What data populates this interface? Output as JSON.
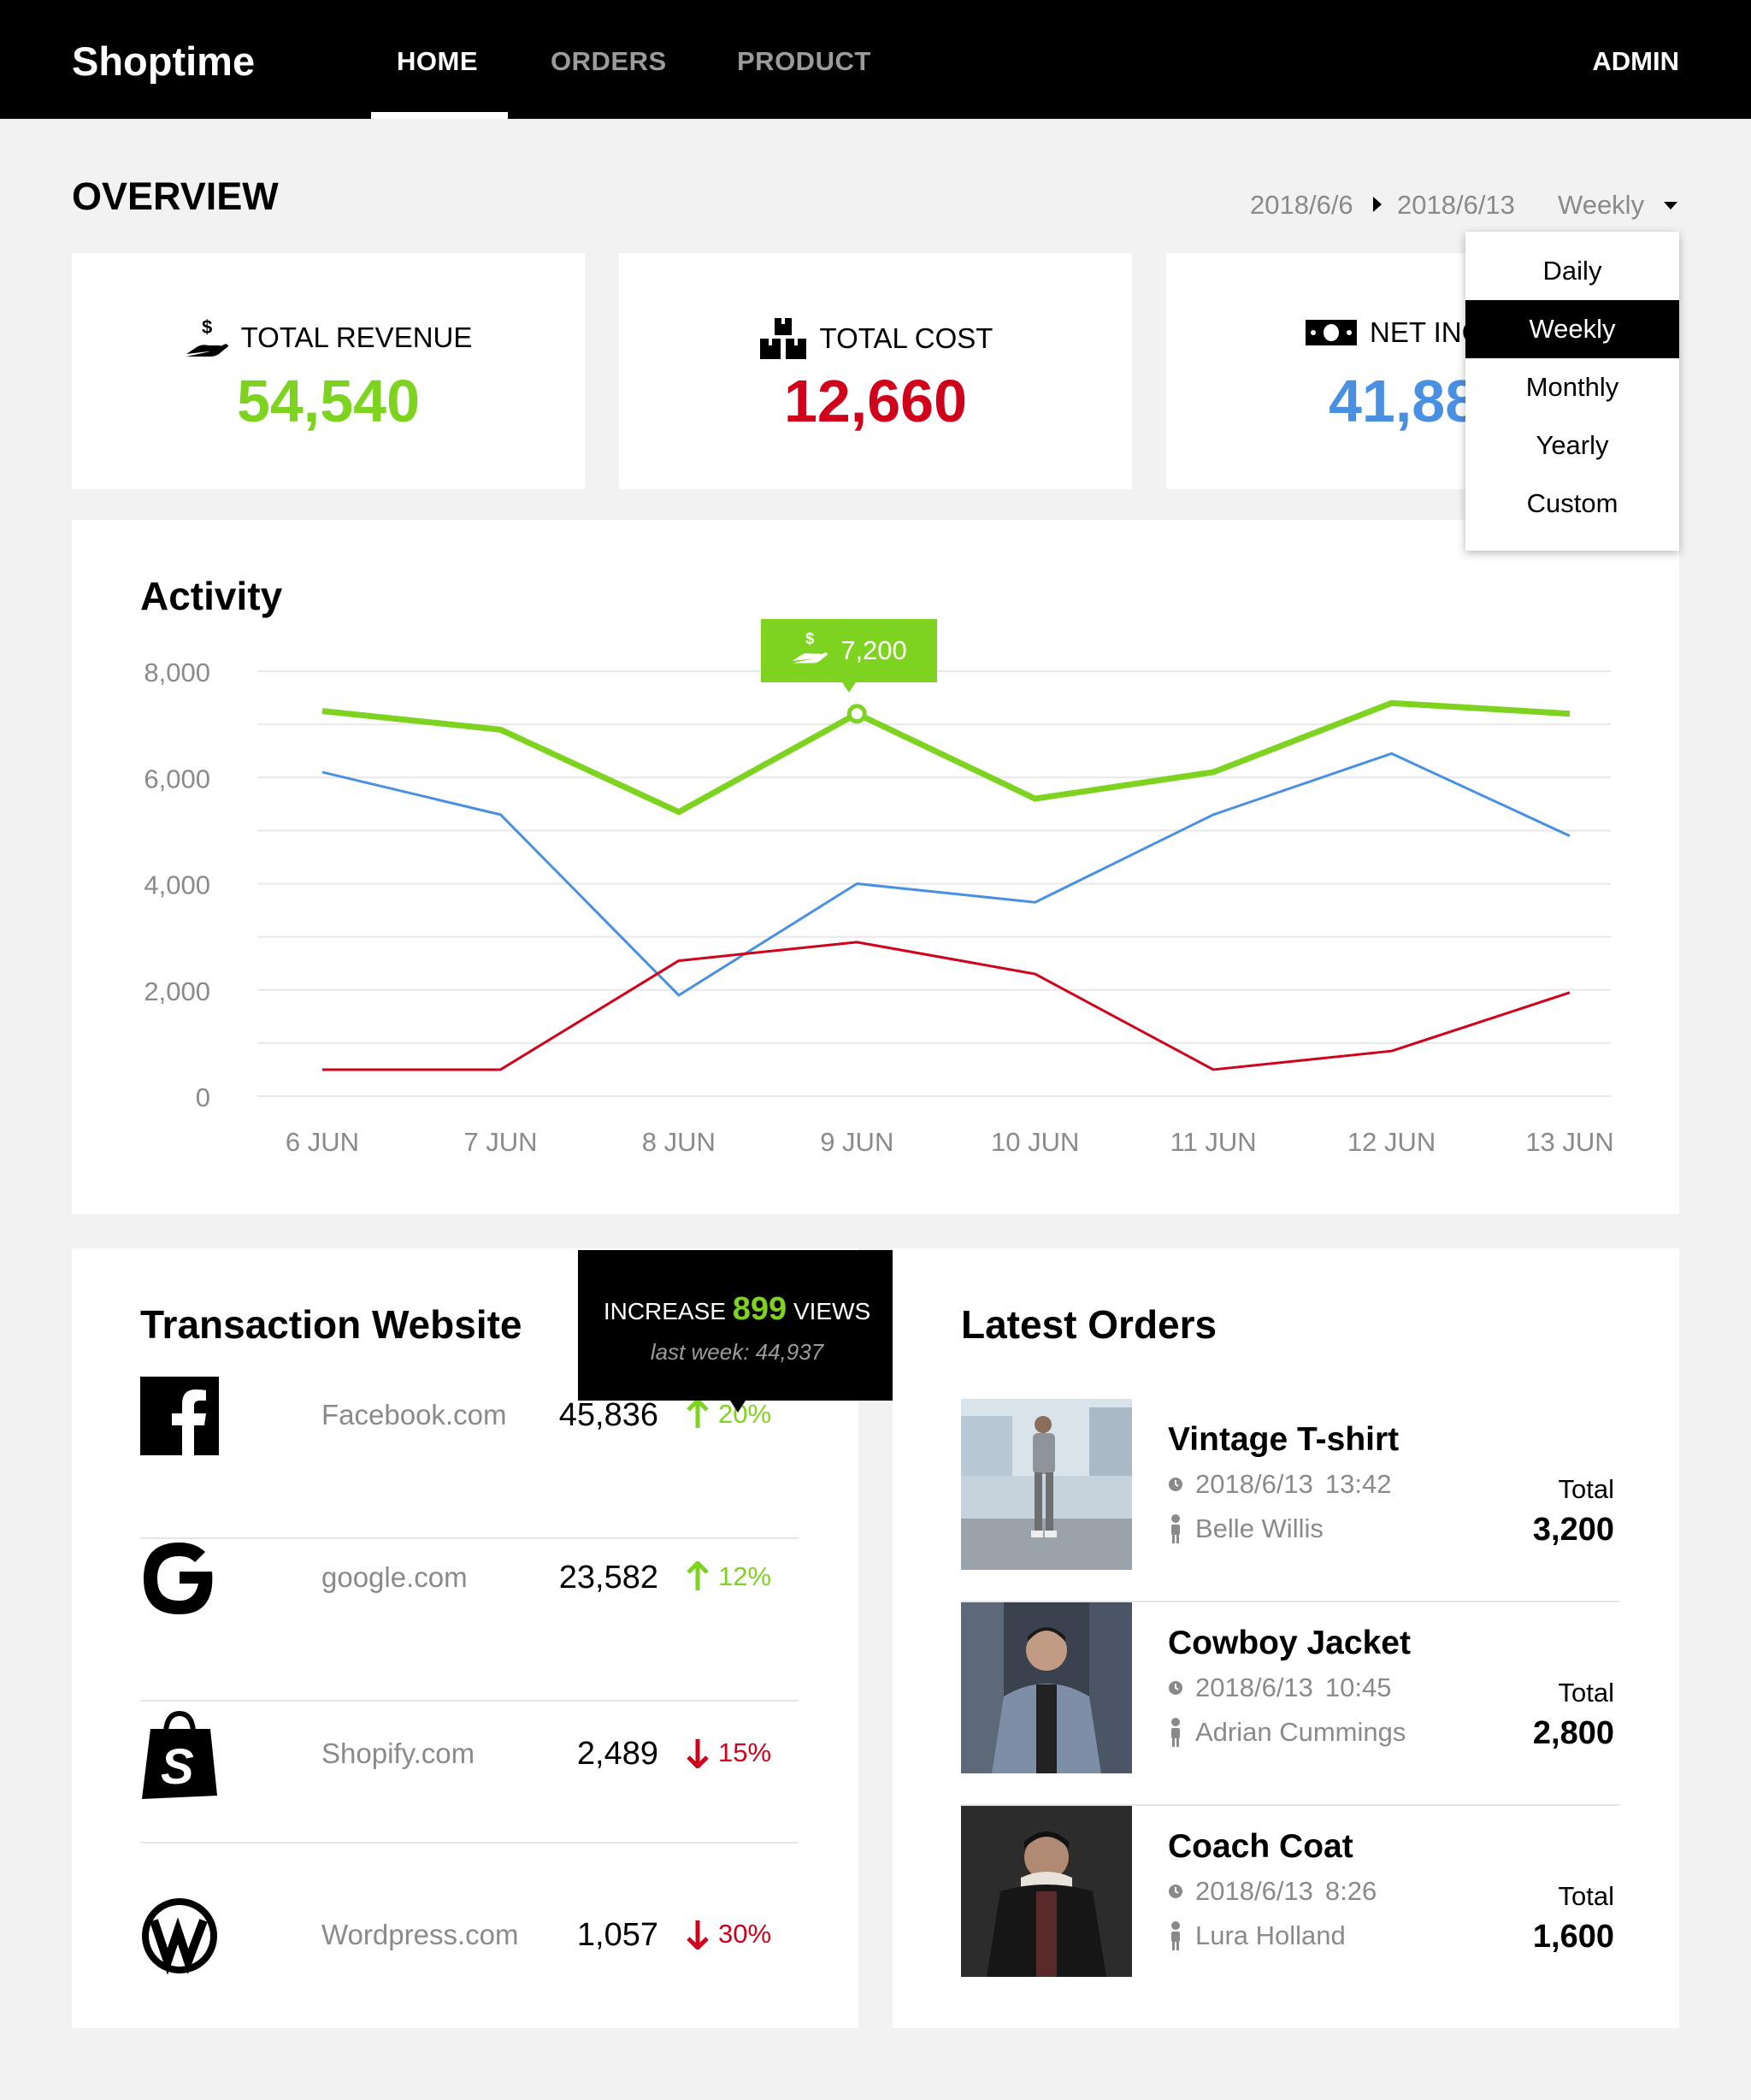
{
  "nav": {
    "brand": "Shoptime",
    "tabs": [
      {
        "label": "HOME",
        "active": true
      },
      {
        "label": "ORDERS",
        "active": false
      },
      {
        "label": "PRODUCT",
        "active": false
      }
    ],
    "user": "ADMIN"
  },
  "overview": {
    "title": "OVERVIEW",
    "date_from": "2018/6/6",
    "date_to": "2018/6/13",
    "period": "Weekly",
    "period_options": [
      {
        "label": "Daily",
        "selected": false
      },
      {
        "label": "Weekly",
        "selected": true
      },
      {
        "label": "Monthly",
        "selected": false
      },
      {
        "label": "Yearly",
        "selected": false
      },
      {
        "label": "Custom",
        "selected": false
      }
    ]
  },
  "stats": [
    {
      "label": "TOTAL REVENUE",
      "value": "54,540",
      "color": "#7ed321",
      "icon": "hand-dollar-icon"
    },
    {
      "label": "TOTAL COST",
      "value": "12,660",
      "color": "#d0021b",
      "icon": "boxes-icon"
    },
    {
      "label": "NET INC",
      "value": "41,88",
      "color": "#4a90e2",
      "icon": "banknote-icon"
    }
  ],
  "activity": {
    "title": "Activity",
    "tooltip_value": "7,200",
    "chart_data": {
      "type": "line",
      "categories": [
        "6 JUN",
        "7 JUN",
        "8 JUN",
        "9 JUN",
        "10 JUN",
        "11 JUN",
        "12 JUN",
        "13 JUN"
      ],
      "ylim": [
        0,
        8000
      ],
      "yticks": [
        "0",
        "2,000",
        "4,000",
        "6,000",
        "8,000"
      ],
      "ytick_values": [
        0,
        2000,
        4000,
        6000,
        8000
      ],
      "grid": true,
      "series": [
        {
          "color": "#7ed321",
          "values": [
            7250,
            6900,
            5350,
            7200,
            5600,
            6100,
            7400,
            7200
          ]
        },
        {
          "color": "#4a90e2",
          "values": [
            6100,
            5300,
            1900,
            4000,
            3650,
            5300,
            6450,
            4900
          ]
        },
        {
          "color": "#d0021b",
          "values": [
            500,
            500,
            2550,
            2900,
            2300,
            500,
            850,
            1950
          ]
        }
      ]
    }
  },
  "transactions": {
    "title": "Transaction Website",
    "tooltip": {
      "prefix": "INCREASE",
      "number": "899",
      "suffix": "VIEWS",
      "sub": "last week: 44,937"
    },
    "sites": [
      {
        "name": "Facebook.com",
        "count": "45,836",
        "change": "20%",
        "direction": "up",
        "icon": "facebook-icon"
      },
      {
        "name": "google.com",
        "count": "23,582",
        "change": "12%",
        "direction": "up",
        "icon": "google-icon"
      },
      {
        "name": "Shopify.com",
        "count": "2,489",
        "change": "15%",
        "direction": "down",
        "icon": "shopify-icon"
      },
      {
        "name": "Wordpress.com",
        "count": "1,057",
        "change": "30%",
        "direction": "down",
        "icon": "wordpress-icon"
      }
    ]
  },
  "orders": {
    "title": "Latest Orders",
    "total_label": "Total",
    "items": [
      {
        "product": "Vintage T-shirt",
        "date": "2018/6/13",
        "time": "13:42",
        "customer": "Belle Willis",
        "total": "3,200"
      },
      {
        "product": "Cowboy Jacket",
        "date": "2018/6/13",
        "time": "10:45",
        "customer": "Adrian Cummings",
        "total": "2,800"
      },
      {
        "product": "Coach Coat",
        "date": "2018/6/13",
        "time": "8:26",
        "customer": "Lura Holland",
        "total": "1,600"
      }
    ]
  }
}
